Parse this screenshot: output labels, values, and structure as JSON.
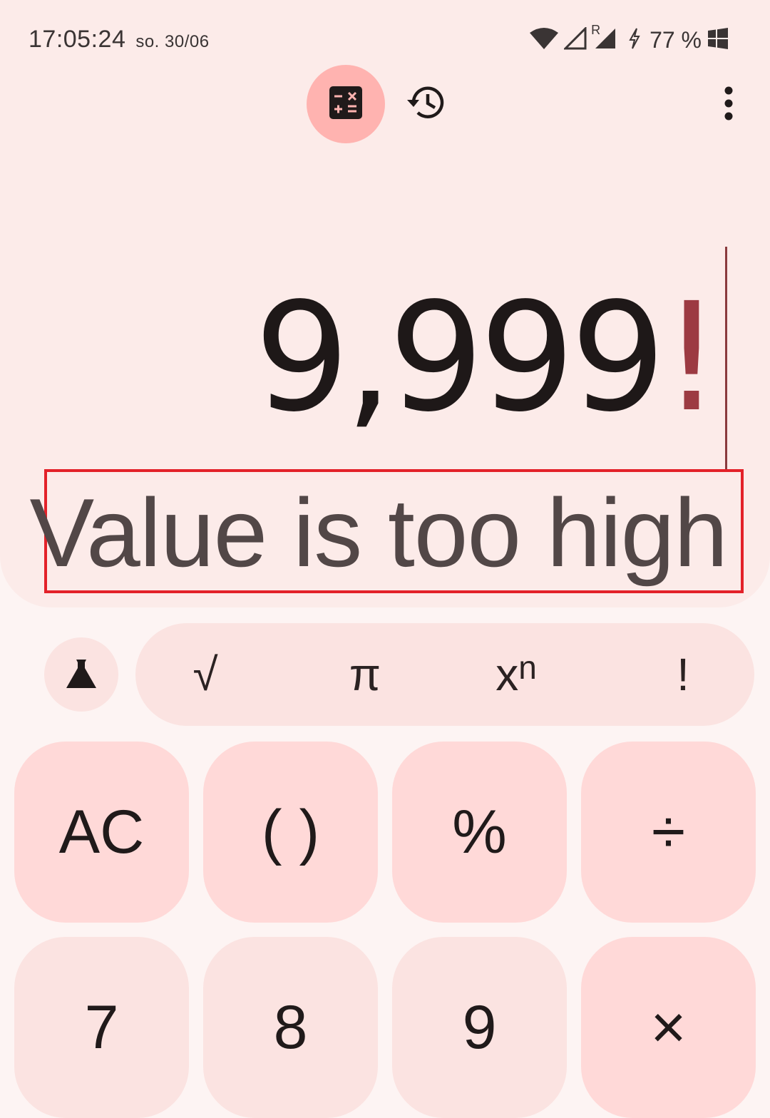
{
  "status_bar": {
    "time": "17:05:24",
    "date": "so. 30/06",
    "battery": "77 %",
    "roaming_indicator": "R"
  },
  "toolbar": {
    "calculator_icon": "calculator-icon",
    "history_icon": "history-icon",
    "more_icon": "more-vert-icon"
  },
  "display": {
    "expression": "9,999",
    "operator": "!",
    "result": "Value is too high"
  },
  "scientific": {
    "toggle_icon": "flask-icon",
    "keys": {
      "sqrt": "√",
      "pi": "π",
      "power_base": "x",
      "power_exp": "n",
      "factorial": "!"
    }
  },
  "keypad": {
    "ac": "AC",
    "parens": "( )",
    "percent": "%",
    "divide": "÷",
    "seven": "7",
    "eight": "8",
    "nine": "9",
    "multiply": "×"
  },
  "colors": {
    "display_bg": "#fcebe9",
    "accent": "#ffb3b0",
    "operator_key_bg": "#ffd9d8",
    "error_operator": "#9c3a42",
    "highlight_box": "#e32129"
  }
}
